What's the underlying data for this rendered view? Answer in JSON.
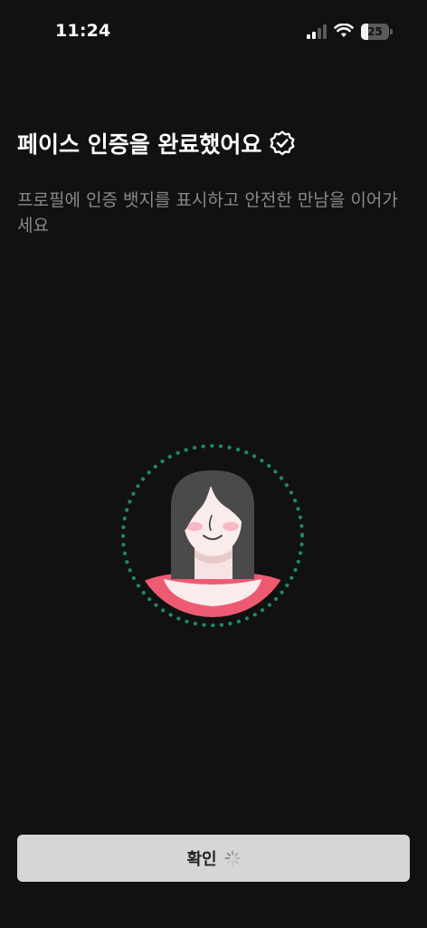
{
  "status_bar": {
    "time": "11:24",
    "battery_percent": "25",
    "battery_level": 0.25,
    "signal_icon": "cellular-signal-icon",
    "wifi_icon": "wifi-icon",
    "battery_icon": "battery-icon"
  },
  "header": {
    "title": "페이스 인증을 완료했어요",
    "title_icon": "verified-badge-icon",
    "subtitle": "프로필에 인증 뱃지를 표시하고 안전한 만남을 이어가세요"
  },
  "illustration": {
    "icon": "woman-avatar-illustration",
    "ring_color": "#1f8a64",
    "accent_color": "#ef5a73"
  },
  "footer": {
    "confirm_label": "확인",
    "loading_icon": "loading-spinner-icon"
  },
  "colors": {
    "background": "#111111",
    "button_bg": "#d6d6d6",
    "subtitle_text": "#8a8a8a"
  }
}
